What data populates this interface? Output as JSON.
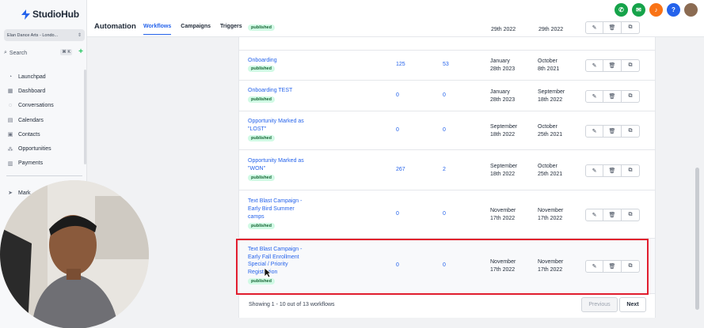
{
  "app": {
    "logo_text": "StudioHub",
    "account_name": "Elan Dance Arts - Londo...",
    "search_label": "Search",
    "search_shortcut": "⌘ K"
  },
  "sidebar": {
    "items": [
      {
        "icon": "rocket-icon",
        "label": "Launchpad"
      },
      {
        "icon": "dashboard-icon",
        "label": "Dashboard"
      },
      {
        "icon": "chat-icon",
        "label": "Conversations"
      },
      {
        "icon": "calendar-icon",
        "label": "Calendars"
      },
      {
        "icon": "contacts-icon",
        "label": "Contacts"
      },
      {
        "icon": "opportunities-icon",
        "label": "Opportunities"
      },
      {
        "icon": "payments-icon",
        "label": "Payments"
      }
    ],
    "secondary_partial": "Mark"
  },
  "header": {
    "title": "Automation",
    "tabs": [
      {
        "label": "Workflows",
        "active": true
      },
      {
        "label": "Campaigns",
        "active": false
      },
      {
        "label": "Triggers",
        "active": false
      }
    ],
    "icons": [
      {
        "name": "phone-icon",
        "color": "#16a34a"
      },
      {
        "name": "megaphone-icon",
        "color": "#16a34a"
      },
      {
        "name": "bell-icon",
        "color": "#f97316"
      },
      {
        "name": "help-icon",
        "color": "#2563eb"
      }
    ]
  },
  "table": {
    "top_partial": {
      "badge": "published",
      "created": "29th 2022",
      "updated": "29th 2022"
    },
    "rows": [
      {
        "name": [
          "Onboarding"
        ],
        "badge": "published",
        "enrolled": "125",
        "active": "53",
        "created": [
          "January",
          "28th 2023"
        ],
        "updated": [
          "October",
          "8th 2021"
        ]
      },
      {
        "name": [
          "Onboarding TEST"
        ],
        "badge": "published",
        "enrolled": "0",
        "active": "0",
        "created": [
          "January",
          "28th 2023"
        ],
        "updated": [
          "September",
          "18th 2022"
        ]
      },
      {
        "name": [
          "Opportunity Marked as",
          "\"LOST\""
        ],
        "badge": "published",
        "enrolled": "0",
        "active": "0",
        "created": [
          "September",
          "18th 2022"
        ],
        "updated": [
          "October",
          "25th 2021"
        ]
      },
      {
        "name": [
          "Opportunity Marked as",
          "\"WON\""
        ],
        "badge": "published",
        "enrolled": "267",
        "active": "2",
        "created": [
          "September",
          "18th 2022"
        ],
        "updated": [
          "October",
          "25th 2021"
        ]
      },
      {
        "name": [
          "Text Blast Campaign -",
          "Early Bird Summer",
          "camps"
        ],
        "badge": "published",
        "enrolled": "0",
        "active": "0",
        "created": [
          "November",
          "17th 2022"
        ],
        "updated": [
          "November",
          "17th 2022"
        ]
      },
      {
        "name": [
          "Text Blast Campaign -",
          "Early Fall Enrollment",
          "Special / Priority",
          "Registration"
        ],
        "badge": "published",
        "enrolled": "0",
        "active": "0",
        "created": [
          "November",
          "17th 2022"
        ],
        "updated": [
          "November",
          "17th 2022"
        ]
      }
    ],
    "footer_text": "Showing 1 - 10 out of 13 workflows",
    "prev_label": "Previous",
    "next_label": "Next"
  },
  "colors": {
    "accent": "#2563eb",
    "highlight": "#e11d2e",
    "badge_bg": "#d1fae5",
    "badge_text": "#166534"
  }
}
